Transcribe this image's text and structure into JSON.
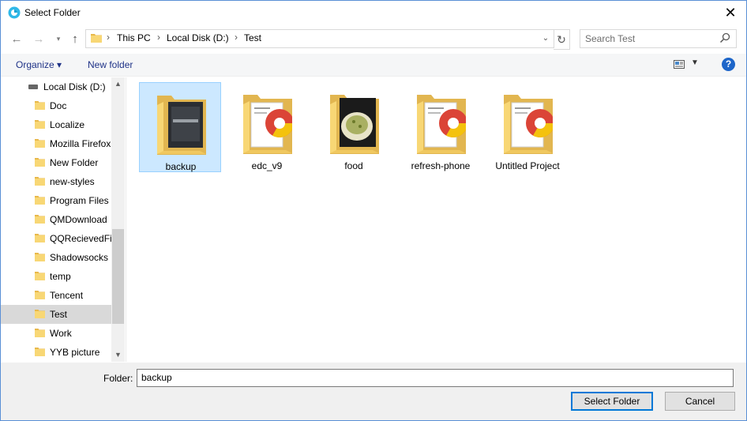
{
  "window": {
    "title": "Select Folder"
  },
  "address": {
    "crumbs": [
      "This PC",
      "Local Disk (D:)",
      "Test"
    ]
  },
  "search": {
    "placeholder": "Search Test"
  },
  "toolbar": {
    "organize": "Organize ▾",
    "new_folder": "New folder",
    "help": "?"
  },
  "nav": {
    "drive": "Local Disk (D:)",
    "items": [
      "Doc",
      "Localize",
      "Mozilla Firefox",
      "New Folder",
      "new-styles",
      "Program Files (",
      "QMDownload",
      "QQRecievedFil",
      "Shadowsocks",
      "temp",
      "Tencent",
      "Test",
      "Work",
      "YYB picture"
    ],
    "selected": "Test"
  },
  "content": {
    "items": [
      {
        "label": "backup",
        "selected": true,
        "preview": "dark-image"
      },
      {
        "label": "edc_v9",
        "selected": false,
        "preview": "chrome-doc"
      },
      {
        "label": "food",
        "selected": false,
        "preview": "food-photo"
      },
      {
        "label": "refresh-phone",
        "selected": false,
        "preview": "chrome-doc"
      },
      {
        "label": "Untitled Project",
        "selected": false,
        "preview": "chrome-doc"
      }
    ]
  },
  "footer": {
    "folder_label": "Folder:",
    "folder_value": "backup",
    "select_button": "Select Folder",
    "cancel_button": "Cancel"
  },
  "colors": {
    "accent": "#0078d7",
    "link": "#1e3287",
    "selection": "#cce8ff",
    "folder": "#f8d775"
  }
}
